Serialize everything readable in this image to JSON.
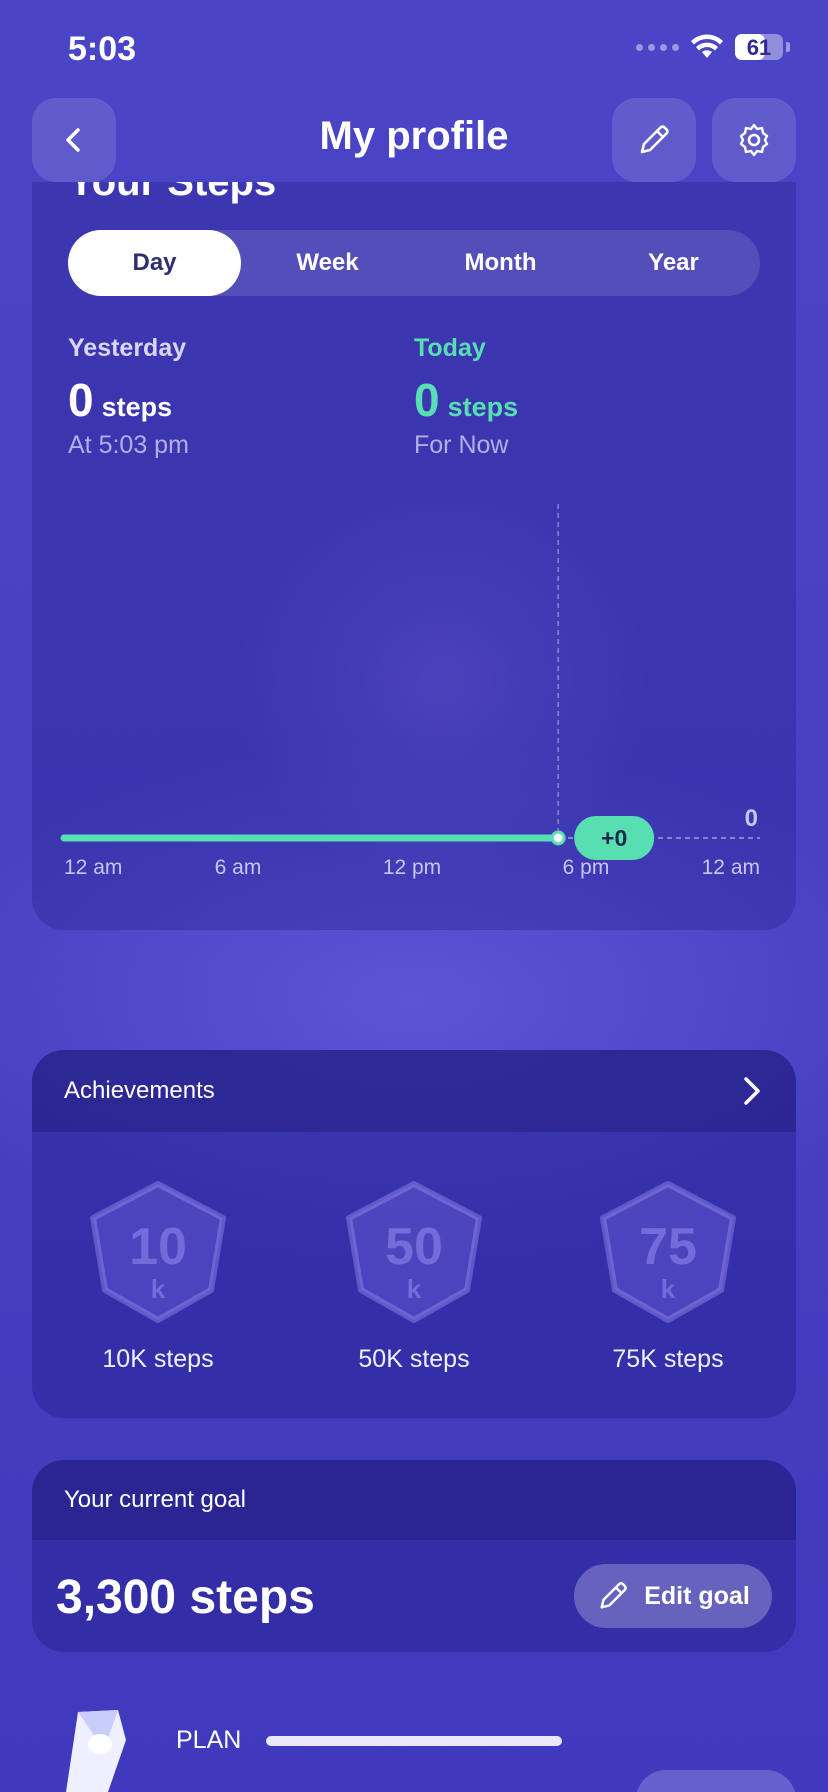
{
  "status_bar": {
    "time": "5:03",
    "battery": "61"
  },
  "header": {
    "title": "My profile"
  },
  "steps_card": {
    "heading": "Your Steps",
    "tabs": [
      {
        "label": "Day",
        "active": true
      },
      {
        "label": "Week",
        "active": false
      },
      {
        "label": "Month",
        "active": false
      },
      {
        "label": "Year",
        "active": false
      }
    ],
    "yesterday": {
      "label": "Yesterday",
      "value": "0",
      "unit": "steps",
      "sub": "At 5:03 pm"
    },
    "today": {
      "label": "Today",
      "value": "0",
      "unit": "steps",
      "sub": "For Now"
    },
    "chart": {
      "x_labels": [
        "12 am",
        "6 am",
        "12 pm",
        "6 pm",
        "12 am"
      ],
      "current_marker_label": "+0",
      "y_value_label": "0",
      "progress_fraction_of_day": 0.71,
      "colors": {
        "progress": "#57dfb2",
        "marker": "#57dfb2"
      }
    }
  },
  "achievements": {
    "title": "Achievements",
    "badges": [
      {
        "number": "10",
        "unit": "k",
        "label": "10K steps"
      },
      {
        "number": "50",
        "unit": "k",
        "label": "50K steps"
      },
      {
        "number": "75",
        "unit": "k",
        "label": "75K steps"
      }
    ]
  },
  "goal": {
    "title": "Your current goal",
    "value": "3,300 steps",
    "edit_label": "Edit goal"
  },
  "plan": {
    "label": "PLAN"
  },
  "colors": {
    "accent": "#57dfb2",
    "background": "#4741c3"
  }
}
